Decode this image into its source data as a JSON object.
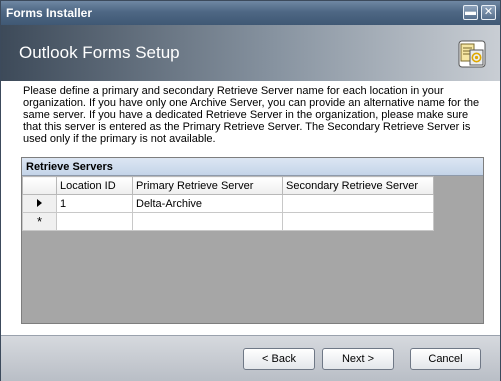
{
  "window": {
    "title": "Forms Installer"
  },
  "titlebar_buttons": {
    "minimize": "▬",
    "close": "✕"
  },
  "banner": {
    "heading": "Outlook Forms Setup",
    "icon": "forms-install-icon"
  },
  "description": "Please define a primary and secondary Retrieve Server name for each location in your organization. If you have only one Archive Server, you can provide an alternative name for the same server. If you have a dedicated Retrieve Server in the organization, please make sure that this server is entered as the Primary Retrieve Server. The Secondary Retrieve Server is used only if the primary is not available.",
  "grid": {
    "caption": "Retrieve Servers",
    "columns": [
      "Location ID",
      "Primary Retrieve Server",
      "Secondary Retrieve Server"
    ],
    "rows": [
      {
        "location_id": "1",
        "primary": "Delta-Archive",
        "secondary": ""
      }
    ],
    "new_row_marker": "*"
  },
  "buttons": {
    "back": "< Back",
    "next": "Next >",
    "cancel": "Cancel"
  }
}
